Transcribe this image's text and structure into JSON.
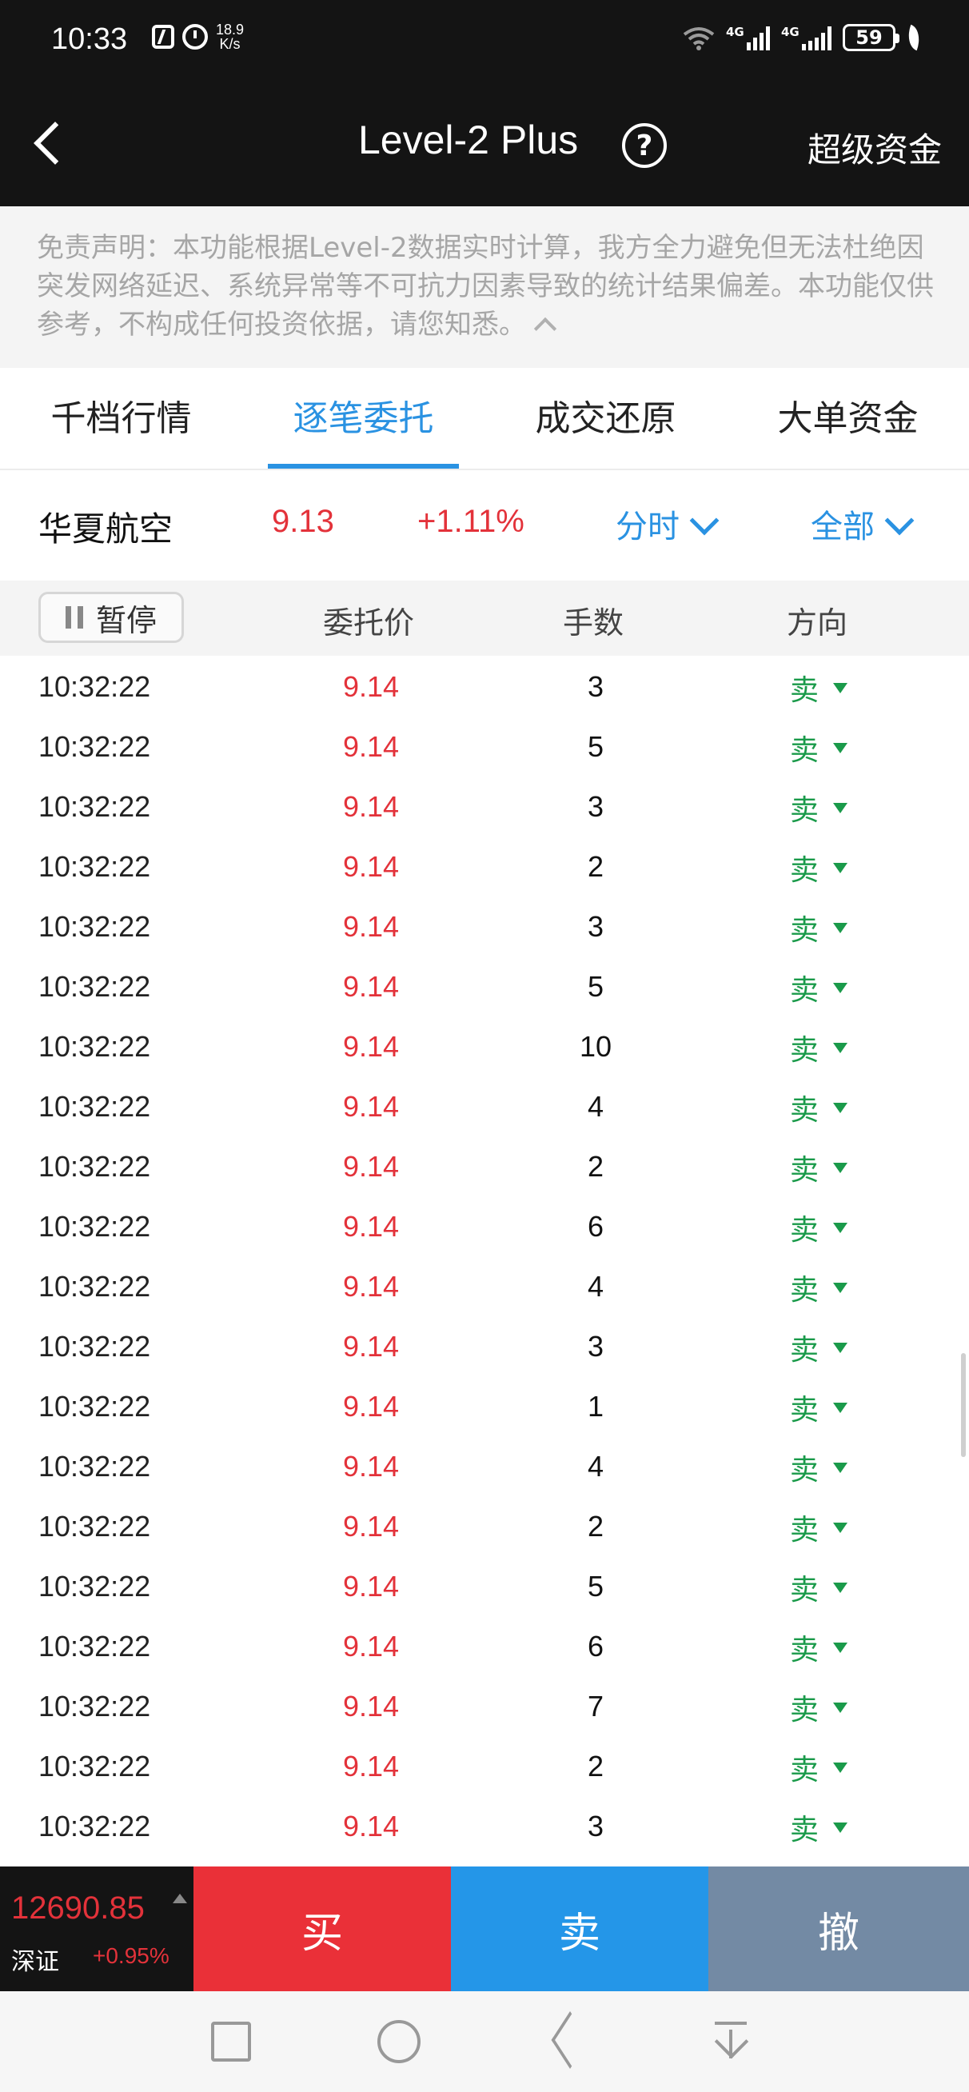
{
  "status_bar": {
    "time": "10:33",
    "net_speed_top": "18.9",
    "net_speed_bottom": "K/s",
    "sim1_label": "4G",
    "sim2_label": "4G",
    "battery": "59"
  },
  "nav": {
    "title": "Level-2 Plus",
    "help_glyph": "?",
    "right_action": "超级资金"
  },
  "disclaimer": {
    "text": "免责声明：本功能根据Level-2数据实时计算，我方全力避免但无法杜绝因突发网络延迟、系统异常等不可抗力因素导致的统计结果偏差。本功能仅供参考，不构成任何投资依据，请您知悉。"
  },
  "tabs": [
    {
      "label": "千档行情"
    },
    {
      "label": "逐笔委托"
    },
    {
      "label": "成交还原"
    },
    {
      "label": "大单资金"
    }
  ],
  "active_tab_index": 1,
  "stock": {
    "name": "华夏航空",
    "price": "9.13",
    "change": "+1.11%",
    "period_dropdown": "分时",
    "filter_dropdown": "全部"
  },
  "table": {
    "pause_label": "暂停",
    "col_price": "委托价",
    "col_qty": "手数",
    "col_dir": "方向",
    "rows": [
      {
        "time": "10:32:22",
        "price": "9.14",
        "qty": "3",
        "dir": "卖"
      },
      {
        "time": "10:32:22",
        "price": "9.14",
        "qty": "5",
        "dir": "卖"
      },
      {
        "time": "10:32:22",
        "price": "9.14",
        "qty": "3",
        "dir": "卖"
      },
      {
        "time": "10:32:22",
        "price": "9.14",
        "qty": "2",
        "dir": "卖"
      },
      {
        "time": "10:32:22",
        "price": "9.14",
        "qty": "3",
        "dir": "卖"
      },
      {
        "time": "10:32:22",
        "price": "9.14",
        "qty": "5",
        "dir": "卖"
      },
      {
        "time": "10:32:22",
        "price": "9.14",
        "qty": "10",
        "dir": "卖"
      },
      {
        "time": "10:32:22",
        "price": "9.14",
        "qty": "4",
        "dir": "卖"
      },
      {
        "time": "10:32:22",
        "price": "9.14",
        "qty": "2",
        "dir": "卖"
      },
      {
        "time": "10:32:22",
        "price": "9.14",
        "qty": "6",
        "dir": "卖"
      },
      {
        "time": "10:32:22",
        "price": "9.14",
        "qty": "4",
        "dir": "卖"
      },
      {
        "time": "10:32:22",
        "price": "9.14",
        "qty": "3",
        "dir": "卖"
      },
      {
        "time": "10:32:22",
        "price": "9.14",
        "qty": "1",
        "dir": "卖"
      },
      {
        "time": "10:32:22",
        "price": "9.14",
        "qty": "4",
        "dir": "卖"
      },
      {
        "time": "10:32:22",
        "price": "9.14",
        "qty": "2",
        "dir": "卖"
      },
      {
        "time": "10:32:22",
        "price": "9.14",
        "qty": "5",
        "dir": "卖"
      },
      {
        "time": "10:32:22",
        "price": "9.14",
        "qty": "6",
        "dir": "卖"
      },
      {
        "time": "10:32:22",
        "price": "9.14",
        "qty": "7",
        "dir": "卖"
      },
      {
        "time": "10:32:22",
        "price": "9.14",
        "qty": "2",
        "dir": "卖"
      },
      {
        "time": "10:32:22",
        "price": "9.14",
        "qty": "3",
        "dir": "卖"
      }
    ]
  },
  "index": {
    "value": "12690.85",
    "name": "深证",
    "change": "+0.95%"
  },
  "trade_buttons": {
    "buy": "买",
    "sell": "卖",
    "cancel": "撤"
  },
  "colors": {
    "up_red": "#e3323a",
    "sell_green": "#1a9a4a",
    "accent_blue": "#2a92e2",
    "buy_button": "#ea3038",
    "sell_button": "#2496e8",
    "cancel_button": "#738aa4"
  }
}
